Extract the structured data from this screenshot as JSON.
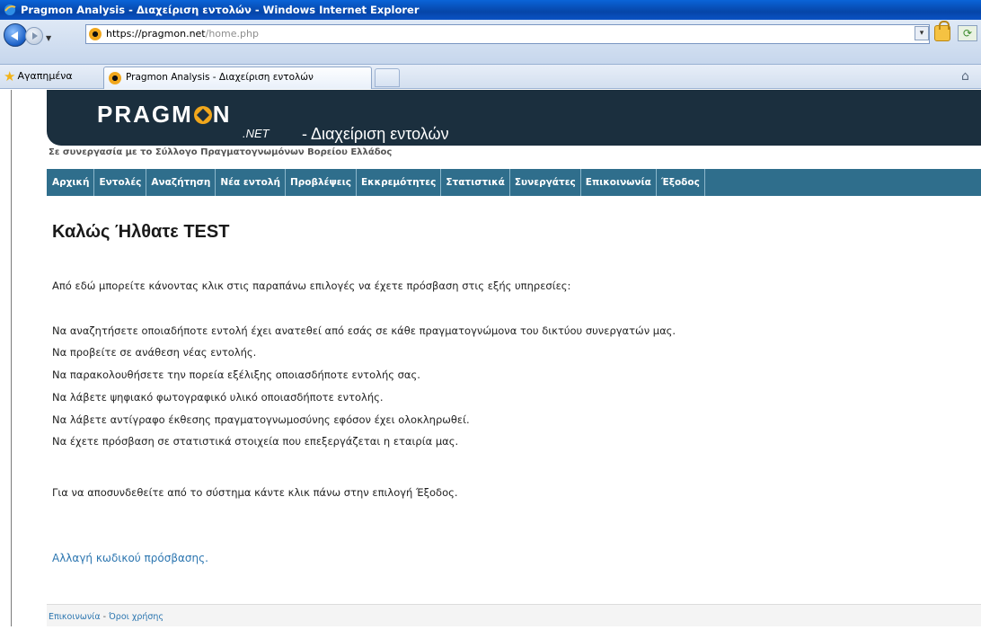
{
  "window": {
    "title": "Pragmon Analysis - Διαχείριση εντολών - Windows Internet Explorer"
  },
  "address": {
    "host": "https://pragmon.net",
    "path": "/home.php"
  },
  "favorites": {
    "label": "Αγαπημένα"
  },
  "tab": {
    "label": "Pragmon Analysis - Διαχείριση εντολών"
  },
  "banner": {
    "logo": "PRAGMON",
    "logo_suffix": ".NET",
    "title": "- Διαχείριση εντολών"
  },
  "partner_text": "Σε συνεργασία με το Σύλλογο Πραγματογνωμόνων Βορείου Ελλάδος",
  "menu": [
    "Αρχική",
    "Εντολές",
    "Αναζήτηση",
    "Νέα εντολή",
    "Προβλέψεις",
    "Εκκρεμότητες",
    "Στατιστικά",
    "Συνεργάτες",
    "Επικοινωνία",
    "Έξοδος"
  ],
  "content": {
    "heading": "Καλώς Ήλθατε TEST",
    "intro": "Από εδώ μπορείτε κάνοντας κλικ στις παραπάνω επιλογές να έχετε πρόσβαση στις εξής υπηρεσίες:",
    "lines": [
      "Να αναζητήσετε οποιαδήποτε εντολή έχει ανατεθεί από εσάς σε κάθε πραγματογνώμονα του δικτύου συνεργατών μας.",
      "Να προβείτε σε ανάθεση νέας εντολής.",
      "Να παρακολουθήσετε την πορεία εξέλιξης οποιασδήποτε εντολής σας.",
      "Να λάβετε ψηφιακό φωτογραφικό υλικό οποιασδήποτε εντολής.",
      "Να λάβετε αντίγραφο έκθεσης πραγματογνωμοσύνης εφόσον έχει ολοκληρωθεί.",
      "Να έχετε πρόσβαση σε στατιστικά στοιχεία που επεξεργάζεται η εταιρία μας."
    ],
    "outro": "Για να αποσυνδεθείτε από το σύστημα κάντε κλικ πάνω στην επιλογή Έξοδος.",
    "password_link": "Αλλαγή κωδικού πρόσβασης."
  },
  "footer": {
    "contact": "Επικοινωνία",
    "separator": " - ",
    "terms": "Όροι χρήσης"
  }
}
